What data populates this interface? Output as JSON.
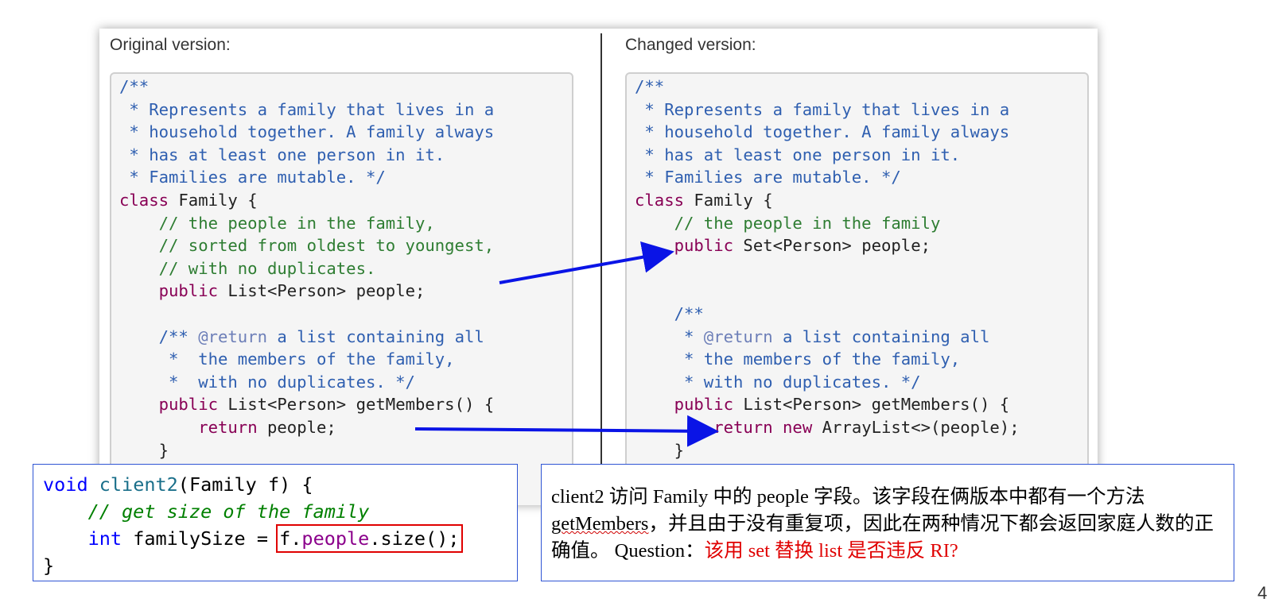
{
  "original": {
    "title": "Original version:",
    "lines": [
      "/**",
      " * Represents a family that lives in a",
      " * household together. A family always",
      " * has at least one person in it.",
      " * Families are mutable. */",
      "class Family {",
      "    // the people in the family,",
      "    // sorted from oldest to youngest,",
      "    // with no duplicates.",
      "    public List<Person> people;",
      "",
      "    /** @return a list containing all",
      "     *  the members of the family,",
      "     *  with no duplicates. */",
      "    public List<Person> getMembers() {",
      "        return people;",
      "    }"
    ]
  },
  "changed": {
    "title": "Changed version:",
    "lines": [
      "/**",
      " * Represents a family that lives in a",
      " * household together. A family always",
      " * has at least one person in it.",
      " * Families are mutable. */",
      "class Family {",
      "    // the people in the family",
      "    public Set<Person> people;",
      "",
      "",
      "    /**",
      "     * @return a list containing all",
      "     * the members of the family,",
      "     * with no duplicates. */",
      "    public List<Person> getMembers() {",
      "        return new ArrayList<>(people);",
      "    }"
    ]
  },
  "client_code": [
    "void client2(Family f) {",
    "    // get size of the family",
    "    int familySize = f.people.size();",
    "}"
  ],
  "note": {
    "text_part1": "client2 访问 Family 中的 people 字段。该字段在俩版本中都有一个方法 ",
    "method_name": "getMembers",
    "text_part2": "，并且由于没有重复项，因此在两种情况下都会返回家庭人数的正确值。 Question：",
    "question": "该用 set 替换 list 是否违反 RI?"
  },
  "page_number": "4",
  "colors": {
    "comment": "#2f5fb0",
    "line_comment": "#2e7d32",
    "keyword": "#880055",
    "arrow": "#0a14e6",
    "highlight_box": "#e00000",
    "question_text": "#e00000"
  }
}
